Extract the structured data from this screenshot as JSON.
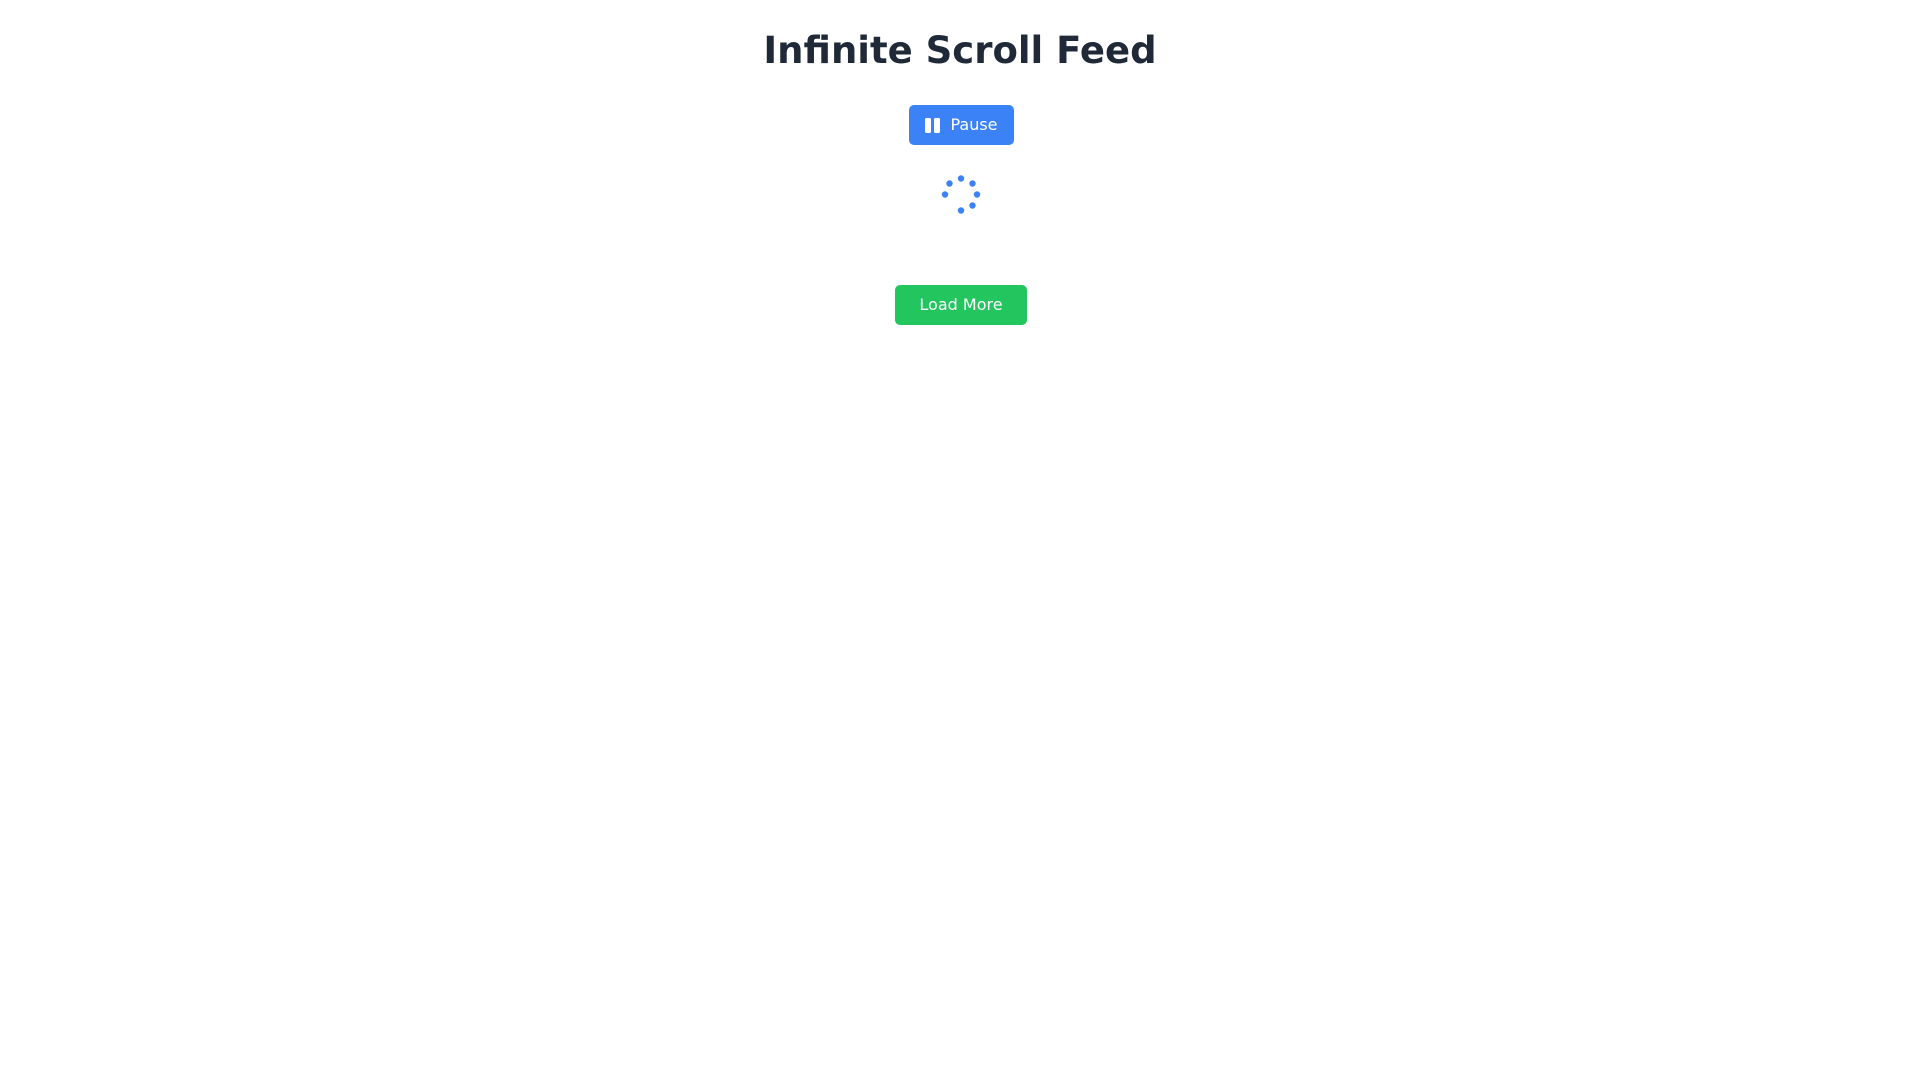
{
  "page": {
    "title": "Infinite Scroll Feed"
  },
  "controls": {
    "pause_label": "Pause",
    "pause_icon": "pause-icon",
    "load_more_label": "Load More"
  },
  "loading": {
    "icon": "spinner-icon"
  },
  "colors": {
    "title": "#1f2937",
    "pause_button": "#3b82f6",
    "load_more_button": "#22c55e",
    "spinner": "#3b82f6",
    "background": "#ffffff"
  }
}
